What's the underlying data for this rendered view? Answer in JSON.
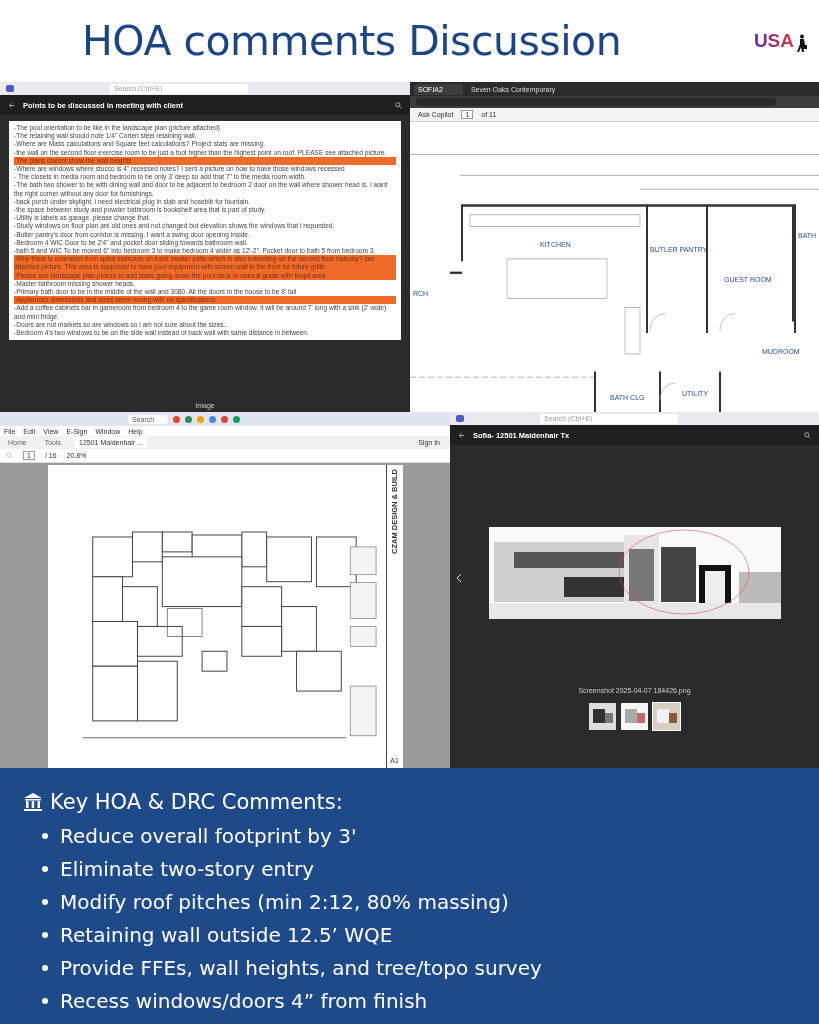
{
  "header": {
    "title": "HOA comments Discussion",
    "logo": "USA"
  },
  "notes_window": {
    "search_placeholder": "Search (Ctrl+E)",
    "title": "Points to be discussed in meeting with client",
    "caption": "Image",
    "lines": [
      {
        "text": "-The pool orientation to be like in the landscape plan (picture attached)",
        "highlighted": false
      },
      {
        "text": "-The retaining wall should note 1/4\" Corten steel retaining wall.",
        "highlighted": false
      },
      {
        "text": "-Where are Mass calculations and Square feet calculations? Project stats are missing.",
        "highlighted": false
      },
      {
        "text": "-the wall on the second floor exercise room to be just a foot higher than the highest point on roof. PLEASE see attached picture.",
        "highlighted": false
      },
      {
        "text": "-The plans doesnt show the wall heights",
        "highlighted": true
      },
      {
        "text": "-Where are windows where stucco is 4\" recessed notes? I sent a picture on how to have those windows recessed",
        "highlighted": false
      },
      {
        "text": "- The closets in media room and bedroom to be only 3' deep so add that 7\" to the media room width.",
        "highlighted": false
      },
      {
        "text": "-The bath two shower to be with dining wall and door to be adjacent to bedroom 2 door on the wall where shower head is. I want the right corner without any door for furnishings.",
        "highlighted": false
      },
      {
        "text": "-back porch under skylight, i need electrical plug in slab and hosebib for fountain.",
        "highlighted": false
      },
      {
        "text": "-the space between study and powder bathroom is bookshelf area that is part of study.",
        "highlighted": false
      },
      {
        "text": "-Utility is labels as garage. please change that.",
        "highlighted": false
      },
      {
        "text": "-Study windows on floor plan are old ones and not changed but elevation shows the windows that i requested.",
        "highlighted": false
      },
      {
        "text": "-Butler pantry's door from corridor is missing. I want a swing door opening inside.",
        "highlighted": false
      },
      {
        "text": "-Bedroom 4 WIC Door to be 2'4\" and pocket door sliding towards bathroom wall.",
        "highlighted": false
      },
      {
        "text": "-bath 5 and WIC To be moved 6\" into bedroom 3 to make bedroom 4 wider as 12'-2\". Pocket door to bath 5 from bedroom 3.",
        "highlighted": false
      },
      {
        "text": "-Why there is extension from spiral staircase on back master patio which is also extending on the second floor balcony? see attached picture. This area is supposed to have pool equipment with screen wall in the front for future grills",
        "highlighted": true
      },
      {
        "text": "-Please see landscape plan picture to add stairs going down the pool deck to natural grade with firepit area",
        "highlighted": true
      },
      {
        "text": "-Master bathroom missing shower heads.",
        "highlighted": false
      },
      {
        "text": "-Primary bath door to be in the middle of the wall and 3080. All the doors in the house to be 8' tall",
        "highlighted": false
      },
      {
        "text": "-Appliances dimensions and sizes seem wrong with no specifications",
        "highlighted": true
      },
      {
        "text": "-Add a coffee cabinets bar in gameroom from bedroom 4 to the game room window. it will be around 7' long with a sink (2' wide) and mini fridge.",
        "highlighted": false
      },
      {
        "text": "-Doors are not markets so are windows so i am not sure about the sizes..",
        "highlighted": false
      },
      {
        "text": "-Bedroom 4's two windows to be on the side wall instead of back wall with same distance in between.",
        "highlighted": false
      }
    ]
  },
  "browser_window": {
    "tabs": [
      {
        "label": "SOFIA2",
        "selected": true
      },
      {
        "label": "Seven Oaks Contemporary",
        "selected": false
      }
    ],
    "copilot": "Ask Copilot",
    "page": "1",
    "page_count": "of 11",
    "rooms": [
      {
        "label": "KITCHEN"
      },
      {
        "label": "BUTLER PANTRY"
      },
      {
        "label": "GUEST ROOM"
      },
      {
        "label": "BATH"
      },
      {
        "label": "RCH"
      },
      {
        "label": "MUDROOM"
      },
      {
        "label": "UTILITY"
      },
      {
        "label": "BATH CLG"
      }
    ]
  },
  "pdf_window": {
    "taskbar_search": "Search",
    "menus": [
      "File",
      "Edit",
      "View",
      "E-Sign",
      "Window",
      "Help"
    ],
    "tabs": [
      {
        "label": "Home",
        "selected": false
      },
      {
        "label": "Tools",
        "selected": false
      },
      {
        "label": "12501 Maidenhair ...",
        "selected": true
      }
    ],
    "sign_in": "Sign In",
    "page": "1",
    "page_count": "/ 16",
    "zoom": "20.8%",
    "firm": "CZAM DESIGN & BUILD",
    "sheet": "A1"
  },
  "viewer_window": {
    "search_placeholder": "Search (Ctrl+E)",
    "title": "Sofia- 12501 Maidenhair Tx",
    "filename": "Screenshot 2025-04-07 184426.png",
    "thumbnails": [
      {
        "selected": false
      },
      {
        "selected": false
      },
      {
        "selected": true
      }
    ]
  },
  "comments": {
    "heading": "Key HOA & DRC Comments:",
    "items": [
      "Reduce overall footprint by 3'",
      "Eliminate two-story entry",
      "Modify roof pitches (min 2:12, 80% massing)",
      "Retaining wall outside 12.5’ WQE",
      "Provide FFEs, wall heights, and tree/topo survey",
      "Recess windows/doors 4” from finish"
    ]
  }
}
